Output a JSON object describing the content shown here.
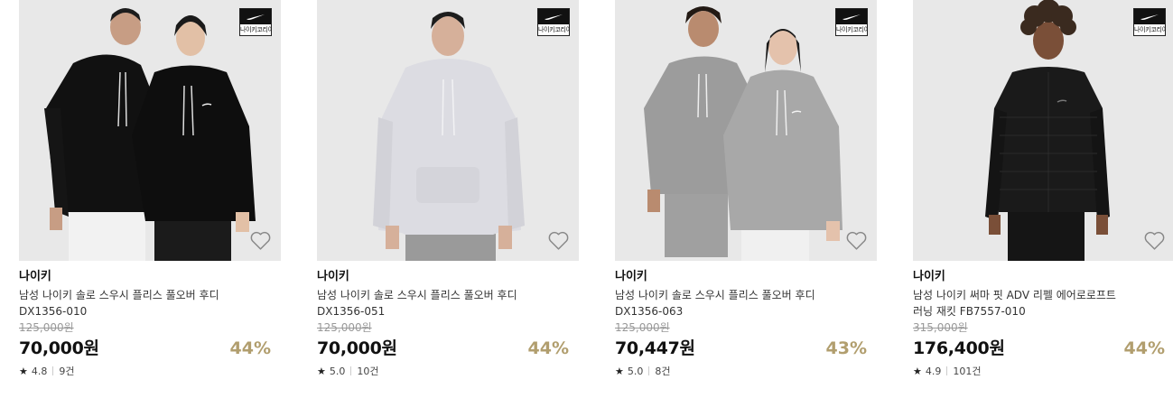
{
  "badge_label": "나이키코리아",
  "colors": {
    "discount": "#b19e6e",
    "thumb_bg": "#e9e9e9"
  },
  "icons": {
    "wishlist": "heart-outline-icon",
    "rating": "star-icon",
    "brand": "nike-swoosh-icon"
  },
  "products": [
    {
      "brand": "나이키",
      "name": "남성 나이키 솔로 스우시 플리스 풀오버 후디 DX1356-010",
      "original_price": "125,000원",
      "price": "70,000원",
      "discount": "44%",
      "star": "★",
      "rating": "4.8",
      "reviews": "9건"
    },
    {
      "brand": "나이키",
      "name": "남성 나이키 솔로 스우시 플리스 풀오버 후디 DX1356-051",
      "original_price": "125,000원",
      "price": "70,000원",
      "discount": "44%",
      "star": "★",
      "rating": "5.0",
      "reviews": "10건"
    },
    {
      "brand": "나이키",
      "name": "남성 나이키 솔로 스우시 플리스 풀오버 후디 DX1356-063",
      "original_price": "125,000원",
      "price": "70,447원",
      "discount": "43%",
      "star": "★",
      "rating": "5.0",
      "reviews": "8건"
    },
    {
      "brand": "나이키",
      "name": "남성 나이키 써마 핏 ADV 리펠 에어로로프트 러닝 재킷 FB7557-010",
      "original_price": "315,000원",
      "price": "176,400원",
      "discount": "44%",
      "star": "★",
      "rating": "4.9",
      "reviews": "101건"
    }
  ]
}
